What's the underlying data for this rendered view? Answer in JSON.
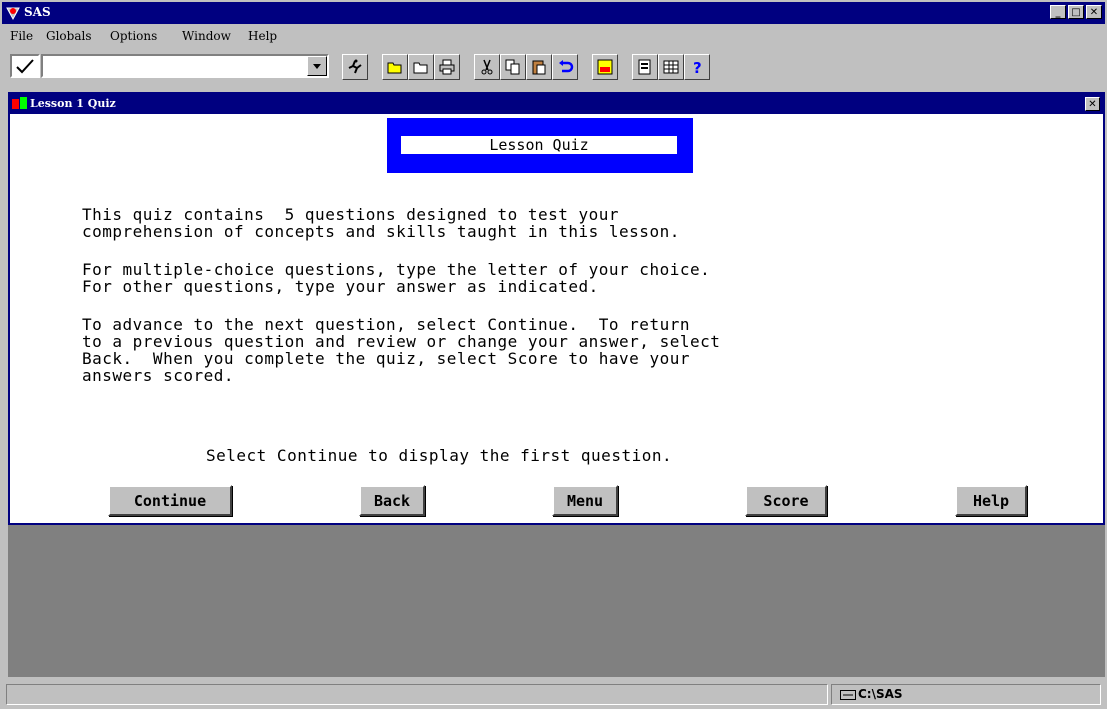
{
  "app": {
    "title": "SAS",
    "window_buttons": {
      "minimize": "_",
      "maximize": "□",
      "close": "✕"
    }
  },
  "menu": {
    "items": [
      "File",
      "Globals",
      "Options",
      "Window",
      "Help"
    ]
  },
  "toolbar": {
    "command_value": "",
    "icons": [
      "submit-icon",
      "open-icon",
      "save-icon",
      "print-icon",
      "cut-icon",
      "copy-icon",
      "paste-icon",
      "undo-icon",
      "explorer-icon",
      "log-icon",
      "options-icon",
      "help-icon"
    ]
  },
  "child_window": {
    "title": "Lesson 1 Quiz",
    "close": "✕"
  },
  "quiz": {
    "heading": "Lesson Quiz",
    "paragraphs": [
      "This quiz contains  5 questions designed to test your\ncomprehension of concepts and skills taught in this lesson.",
      "For multiple-choice questions, type the letter of your choice.\nFor other questions, type your answer as indicated.",
      "To advance to the next question, select Continue.  To return\nto a previous question and review or change your answer, select\nBack.  When you complete the quiz, select Score to have your\nanswers scored."
    ],
    "prompt": "Select Continue to display the first question.",
    "buttons": {
      "continue": "Continue",
      "back": "Back",
      "menu": "Menu",
      "score": "Score",
      "help": "Help"
    }
  },
  "status": {
    "message": "",
    "path": "C:\\SAS"
  }
}
